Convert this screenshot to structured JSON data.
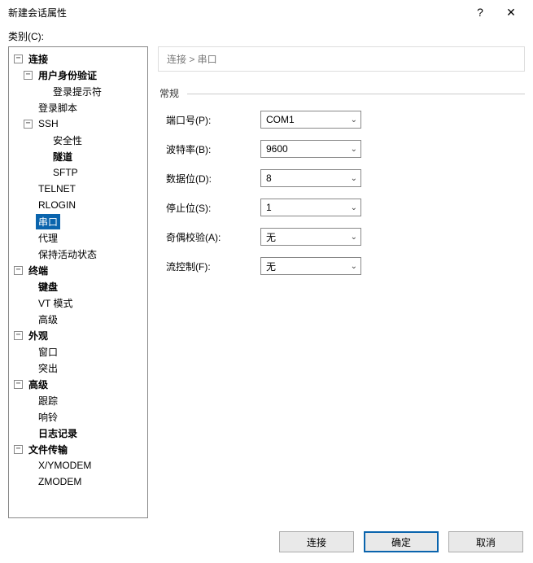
{
  "title": "新建会话属性",
  "help_icon": "?",
  "close_icon": "✕",
  "category_label": "类别(C):",
  "breadcrumb": "连接 > 串口",
  "group_label": "常规",
  "fields": {
    "port": {
      "label": "端口号(P):",
      "value": "COM1"
    },
    "baud": {
      "label": "波特率(B):",
      "value": "9600"
    },
    "databits": {
      "label": "数据位(D):",
      "value": "8"
    },
    "stopbits": {
      "label": "停止位(S):",
      "value": "1"
    },
    "parity": {
      "label": "奇偶校验(A):",
      "value": "无"
    },
    "flow": {
      "label": "流控制(F):",
      "value": "无"
    }
  },
  "tree": {
    "connection": "连接",
    "auth": "用户身份验证",
    "login_prompt": "登录提示符",
    "login_script": "登录脚本",
    "ssh": "SSH",
    "security": "安全性",
    "tunnel": "隧道",
    "sftp": "SFTP",
    "telnet": "TELNET",
    "rlogin": "RLOGIN",
    "serial": "串口",
    "proxy": "代理",
    "keepalive": "保持活动状态",
    "terminal": "终端",
    "keyboard": "键盘",
    "vtmode": "VT 模式",
    "advanced1": "高级",
    "appearance": "外观",
    "window": "窗口",
    "highlight": "突出",
    "advanced": "高级",
    "trace": "跟踪",
    "bell": "响铃",
    "logging": "日志记录",
    "filetransfer": "文件传输",
    "xymodem": "X/YMODEM",
    "zmodem": "ZMODEM"
  },
  "buttons": {
    "connect": "连接",
    "ok": "确定",
    "cancel": "取消"
  }
}
